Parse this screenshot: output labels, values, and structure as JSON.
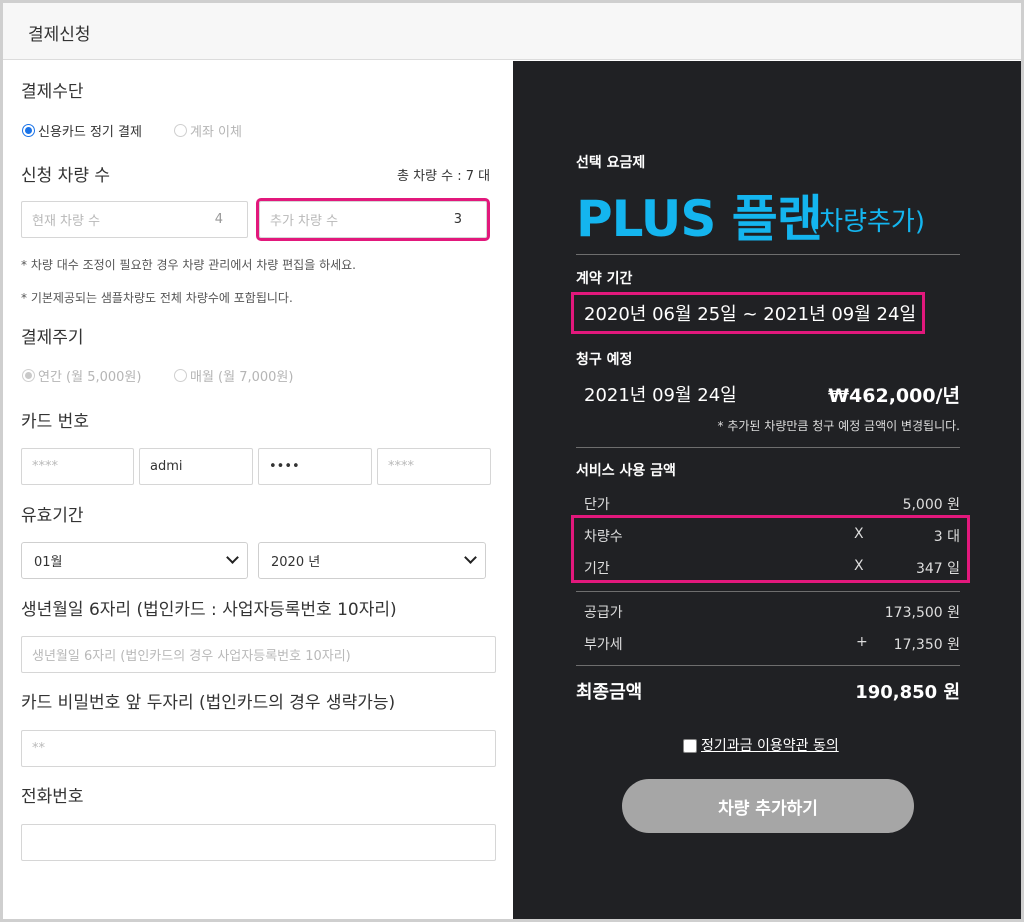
{
  "header": {
    "title": "결제신청"
  },
  "payment_method": {
    "title": "결제수단",
    "options": [
      {
        "label": "신용카드 정기 결제",
        "selected": true
      },
      {
        "label": "계좌 이체",
        "selected": false
      }
    ]
  },
  "vehicles": {
    "title": "신청 차량 수",
    "total_label": "총 차량 수 : 7 대",
    "current": {
      "placeholder": "현재 차량 수",
      "value": "4"
    },
    "added": {
      "placeholder": "추가 차량 수",
      "value": "3"
    },
    "note1": "* 차량 대수 조정이 필요한 경우 차량 관리에서 차량 편집을 하세요.",
    "note2": "* 기본제공되는 샘플차량도 전체 차량수에 포함됩니다."
  },
  "cycle": {
    "title": "결제주기",
    "options": [
      {
        "label": "연간 (월 5,000원)",
        "selected": true
      },
      {
        "label": "매월 (월 7,000원)",
        "selected": false
      }
    ]
  },
  "card": {
    "title": "카드 번호",
    "fields": [
      "****",
      "admi",
      "••••",
      "****"
    ]
  },
  "expiry": {
    "title": "유효기간",
    "month": "01월",
    "year": "2020 년"
  },
  "birth": {
    "title": "생년월일 6자리 (법인카드 : 사업자등록번호 10자리)",
    "placeholder": "생년월일 6자리 (법인카드의 경우 사업자등록번호 10자리)"
  },
  "password": {
    "title": "카드 비밀번호 앞 두자리 (법인카드의 경우 생략가능)",
    "placeholder": "**"
  },
  "phone": {
    "title": "전화번호",
    "placeholder": ""
  },
  "summary": {
    "plan_label": "선택 요금제",
    "plan_name": "PLUS 플랜",
    "plan_sub": "(차량추가)",
    "period_label": "계약 기간",
    "period": "2020년 06월 25일 ~ 2021년 09월 24일",
    "billing_label": "청구 예정",
    "billing_date": "2021년 09월 24일",
    "billing_amount": "₩462,000/년",
    "billing_note": "* 추가된 차량만큼 청구 예정 금액이 변경됩니다.",
    "usage_label": "서비스 사용 금액",
    "rows": [
      {
        "label": "단가",
        "op": "",
        "value": "5,000 원"
      },
      {
        "label": "차량수",
        "op": "X",
        "value": "3 대"
      },
      {
        "label": "기간",
        "op": "X",
        "value": "347 일"
      },
      {
        "label": "공급가",
        "op": "",
        "value": "173,500 원"
      },
      {
        "label": "부가세",
        "op": "+",
        "value": "17,350 원"
      }
    ],
    "total_label": "최종금액",
    "total_value": "190,850 원",
    "agree_label": "정기과금 이용약관 동의",
    "submit_label": "차량 추가하기"
  }
}
